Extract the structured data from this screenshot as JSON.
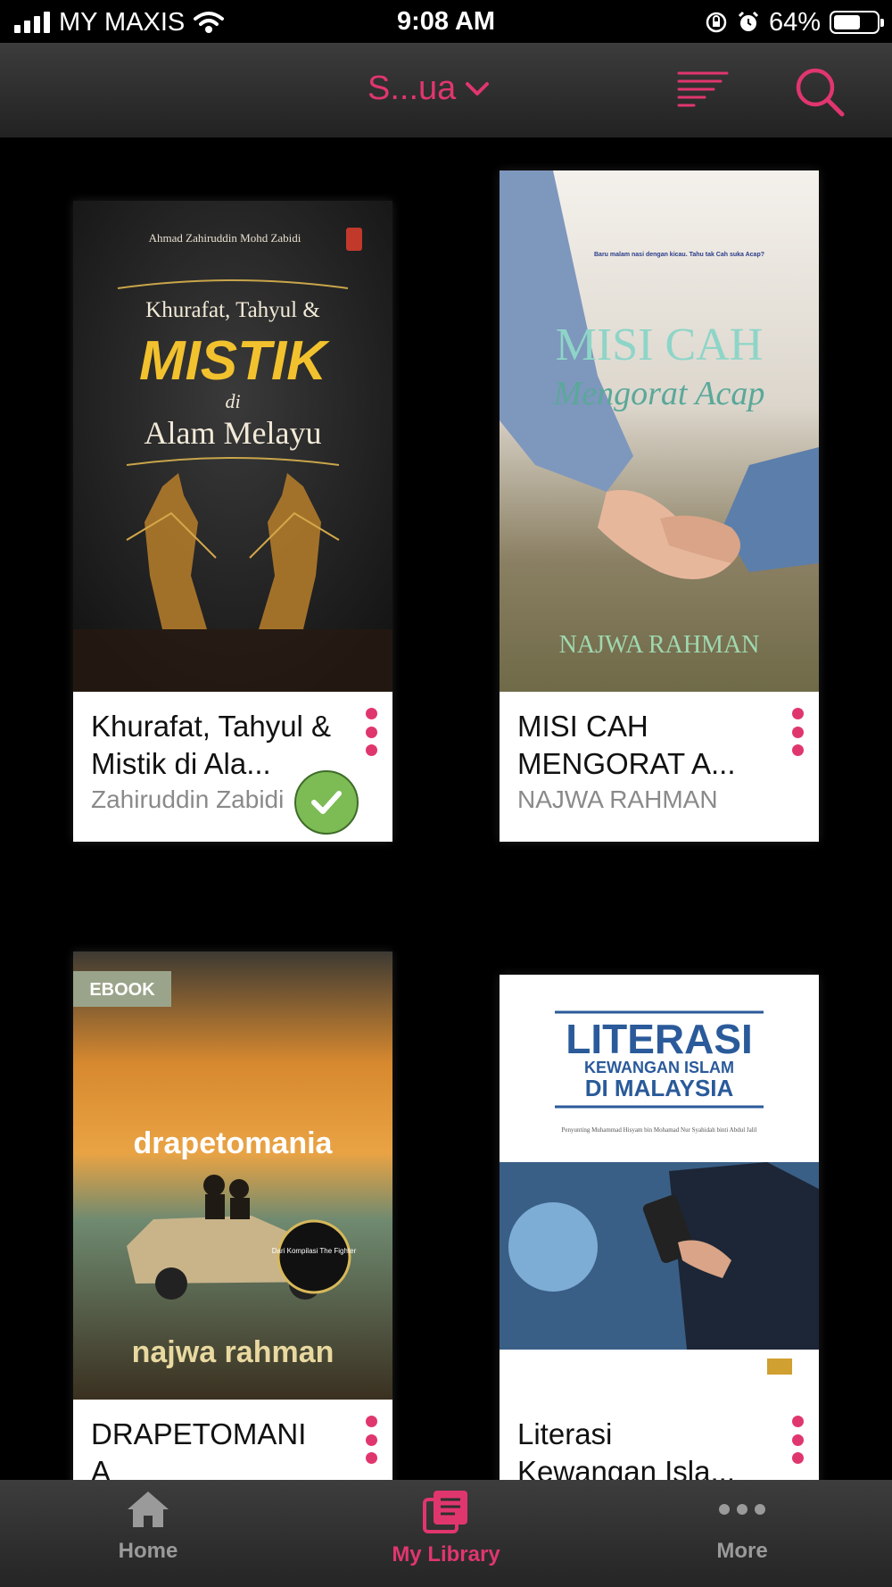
{
  "status_bar": {
    "carrier": "MY MAXIS",
    "time": "9:08 AM",
    "battery": "64%",
    "battery_level": 0.64
  },
  "header": {
    "title": "S...ua",
    "sort_icon": "sort-lines-icon",
    "search_icon": "search-icon",
    "accent": "#e0366e"
  },
  "books": [
    {
      "title": "Khurafat, Tahyul & Mistik di Ala...",
      "author": "Zahiruddin Zabidi",
      "downloaded": true,
      "cover": {
        "top_text": "Ahmad Zahiruddin Mohd Zabidi",
        "line1": "Khurafat, Tahyul &",
        "line2": "MISTIK",
        "line3": "di",
        "line4": "Alam Melayu"
      }
    },
    {
      "title": "MISI CAH MENGORAT A...",
      "author": "NAJWA RAHMAN",
      "downloaded": false,
      "cover": {
        "tagline": "Baru malam nasi dengan kicau. Tahu tak Cah suka Acap?",
        "line1": "MISI CAH",
        "line2": "Mengorat Acap",
        "author": "NAJWA RAHMAN"
      }
    },
    {
      "title": "DRAPETOMANI A",
      "author": "",
      "downloaded": false,
      "cover": {
        "badge": "EBOOK",
        "line1": "drapetomania",
        "seal": "Dari Kompilasi The Fighter",
        "author": "najwa rahman"
      }
    },
    {
      "title": "Literasi Kewangan Isla...",
      "author": "",
      "downloaded": false,
      "cover": {
        "line1": "LITERASI",
        "line2": "KEWANGAN ISLAM",
        "line3": "DI MALAYSIA",
        "editors": "Penyunting Muhammad Hisyam bin Mohamad Nur Syahidah binti Abdul Jalil"
      }
    }
  ],
  "tabbar": {
    "tabs": [
      {
        "label": "Home",
        "icon": "home-icon",
        "active": false
      },
      {
        "label": "My Library",
        "icon": "library-icon",
        "active": true
      },
      {
        "label": "More",
        "icon": "more-dots-icon",
        "active": false
      }
    ]
  }
}
